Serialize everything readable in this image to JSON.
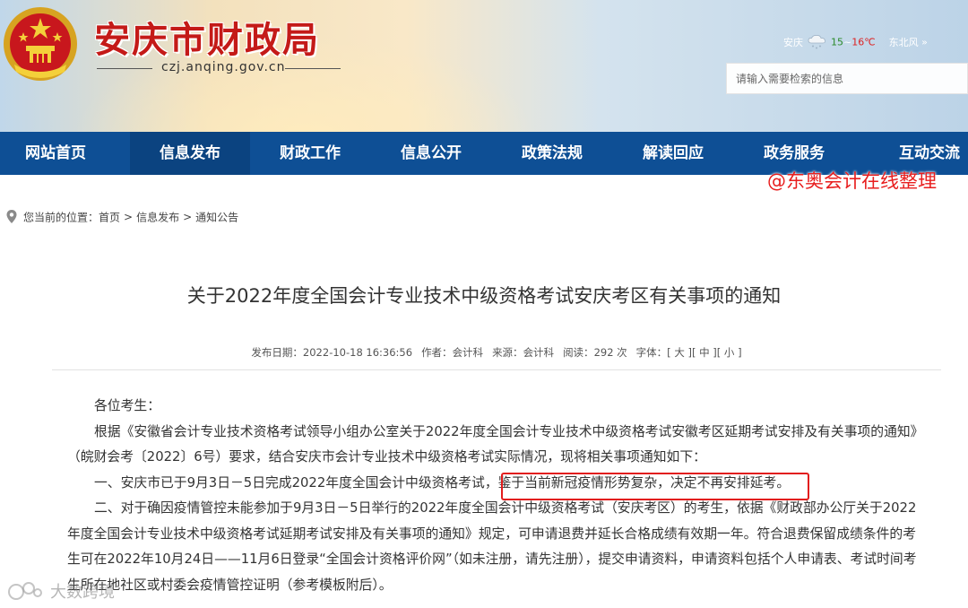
{
  "header": {
    "title": "安庆市财政局",
    "domain": "czj.anqing.gov.cn",
    "weather": {
      "city": "安庆",
      "temp_low": "15",
      "sep": "~",
      "temp_high": "16℃",
      "wind": "东北风",
      "more": "»",
      "icon": "cloud-snow-icon"
    },
    "search_placeholder": "请输入需要检索的信息"
  },
  "nav": {
    "items": [
      {
        "label": "网站首页"
      },
      {
        "label": "信息发布",
        "active": true
      },
      {
        "label": "财政工作"
      },
      {
        "label": "信息公开"
      },
      {
        "label": "政策法规"
      },
      {
        "label": "解读回应"
      },
      {
        "label": "政务服务"
      },
      {
        "label": "互动交流"
      }
    ]
  },
  "watermark": "@东奥会计在线整理",
  "breadcrumb": {
    "prefix": "您当前的位置：",
    "items": [
      "首页",
      "信息发布",
      "通知公告"
    ],
    "sep": ">"
  },
  "article": {
    "title": "关于2022年度全国会计专业技术中级资格考试安庆考区有关事项的通知",
    "meta": {
      "date_label": "发布日期：",
      "date": "2022-10-18 16:36:56",
      "author_label": "作者：",
      "author": "会计科",
      "source_label": "来源：",
      "source": "会计科",
      "views_label": "阅读：",
      "views": "292 次",
      "font_label": "字体：",
      "font_large": "[ 大 ]",
      "font_medium": "[ 中 ]",
      "font_small": "[ 小 ]"
    },
    "salutation": "各位考生：",
    "p1": "根据《安徽省会计专业技术资格考试领导小组办公室关于2022年度全国会计专业技术中级资格考试安徽考区延期考试安排及有关事项的通知》（皖财会考〔2022〕6号）要求，结合安庆市会计专业技术中级资格考试实际情况，现将相关事项通知如下：",
    "p2": "一、安庆市已于9月3日－5日完成2022年度全国会计中级资格考试，鉴于当前新冠疫情形势复杂，决定不再安排延考。",
    "p3": "二、对于确因疫情管控未能参加于9月3日－5日举行的2022年度全国会计中级资格考试（安庆考区）的考生，依据《财政部办公厅关于2022年度全国会计专业技术中级资格考试延期考试安排及有关事项的通知》规定，可申请退费并延长合格成绩有效期一年。符合退费保留成绩条件的考生可在2022年10月24日——11月6日登录“全国会计资格评价网”（如未注册，请先注册），提交申请资料，申请资料包括个人申请表、考试时间考生所在地社区或村委会疫情管控证明（参考模板附后）。"
  },
  "bottom_watermark": "大数跨境",
  "colors": {
    "nav_bg": "#0e4f95",
    "title_red": "#c41a18",
    "highlight_red": "#e21c1c"
  }
}
